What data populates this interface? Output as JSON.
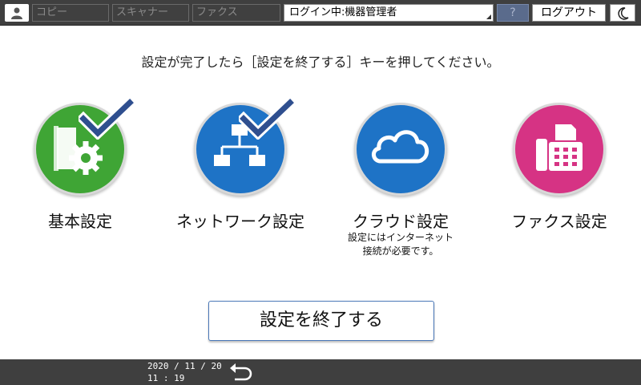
{
  "topbar": {
    "tabs": [
      {
        "label": "コピー"
      },
      {
        "label": "スキャナー"
      },
      {
        "label": "ファクス"
      }
    ],
    "login_status": "ログイン中:機器管理者",
    "help_label": "?",
    "logout_label": "ログアウト"
  },
  "instruction": "設定が完了したら［設定を終了する］キーを押してください。",
  "options": [
    {
      "label": "基本設定",
      "note_lines": [],
      "checked": true,
      "color": "#3fa535",
      "icon": "machine-gear-icon"
    },
    {
      "label": "ネットワーク設定",
      "note_lines": [],
      "checked": true,
      "color": "#1e73c6",
      "icon": "network-icon"
    },
    {
      "label": "クラウド設定",
      "note_lines": [
        "設定にはインターネット",
        "接続が必要です。"
      ],
      "checked": false,
      "color": "#1e73c6",
      "icon": "cloud-icon"
    },
    {
      "label": "ファクス設定",
      "note_lines": [],
      "checked": false,
      "color": "#d63384",
      "icon": "fax-icon"
    }
  ],
  "finish_button": "設定を終了する",
  "statusbar": {
    "date": "2020 / 11 / 20",
    "time": "11 : 19"
  },
  "colors": {
    "bar": "#3f3f3f",
    "check": "#2f4f8f",
    "button_border": "#4a78b8"
  }
}
